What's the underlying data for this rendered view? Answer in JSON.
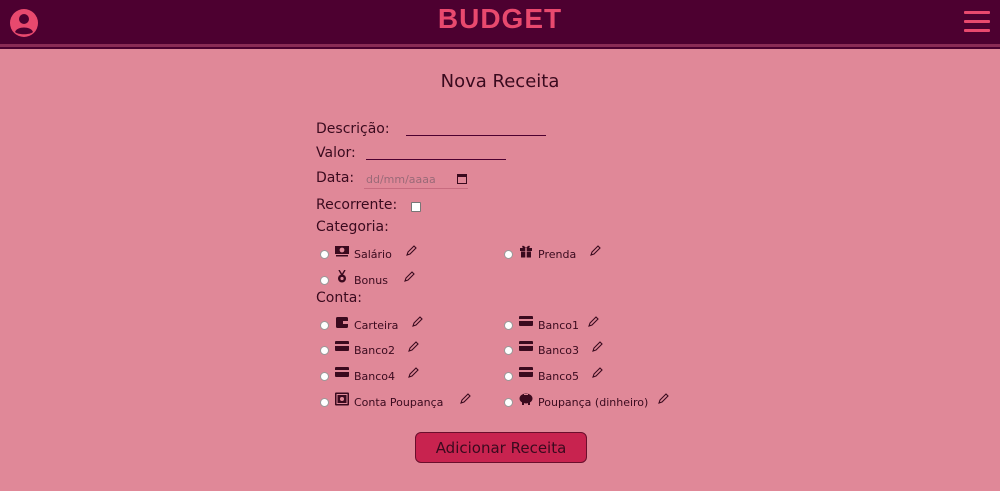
{
  "header": {
    "brand": "BUDGET",
    "user_icon": "user-circle-icon",
    "menu_icon": "hamburger-menu-icon",
    "accent_color": "#e8496e",
    "bar_color": "#4d0030"
  },
  "form": {
    "title": "Nova Receita",
    "descricao_label": "Descrição:",
    "descricao_value": "",
    "valor_label": "Valor:",
    "valor_value": "",
    "data_label": "Data:",
    "data_placeholder": "dd/mm/aaaa",
    "recorrente_label": "Recorrente:",
    "recorrente_checked": false,
    "categoria_label": "Categoria:",
    "categorias": [
      {
        "label": "Salário",
        "icon": "money-icon",
        "selected": false
      },
      {
        "label": "Prenda",
        "icon": "gift-icon",
        "selected": false
      },
      {
        "label": "Bonus",
        "icon": "medal-icon",
        "selected": false
      }
    ],
    "conta_label": "Conta:",
    "contas": [
      {
        "label": "Carteira",
        "icon": "wallet-icon",
        "selected": false
      },
      {
        "label": "Banco1",
        "icon": "card-icon",
        "selected": false
      },
      {
        "label": "Banco2",
        "icon": "card-icon",
        "selected": false
      },
      {
        "label": "Banco3",
        "icon": "card-icon",
        "selected": false
      },
      {
        "label": "Banco4",
        "icon": "card-icon",
        "selected": false
      },
      {
        "label": "Banco5",
        "icon": "card-icon",
        "selected": false
      },
      {
        "label": "Conta Poupança",
        "icon": "safe-icon",
        "selected": false
      },
      {
        "label": "Poupança (dinheiro)",
        "icon": "piggy-bank-icon",
        "selected": false
      }
    ],
    "submit_label": "Adicionar Receita",
    "background_color": "#e08898",
    "button_color": "#c8234f"
  }
}
